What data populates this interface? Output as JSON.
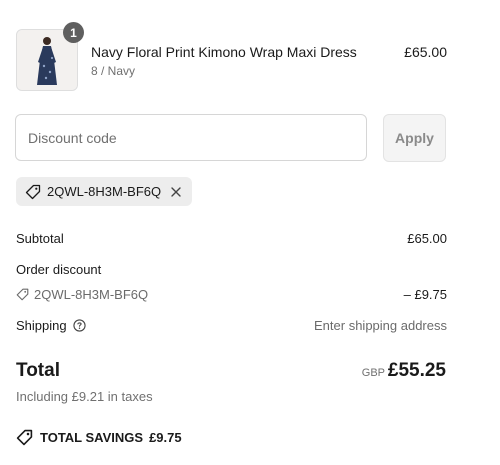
{
  "product": {
    "quantity": "1",
    "name": "Navy Floral Print Kimono Wrap Maxi Dress",
    "variant": "8 / Navy",
    "price": "£65.00"
  },
  "discount": {
    "placeholder": "Discount code",
    "apply_label": "Apply",
    "applied_code": "2QWL-8H3M-BF6Q"
  },
  "summary": {
    "subtotal_label": "Subtotal",
    "subtotal_value": "£65.00",
    "order_discount_label": "Order discount",
    "order_discount_code": "2QWL-8H3M-BF6Q",
    "order_discount_value": "– £9.75",
    "shipping_label": "Shipping",
    "shipping_value": "Enter shipping address"
  },
  "total": {
    "label": "Total",
    "currency": "GBP",
    "amount": "£55.25",
    "tax_note": "Including £9.21 in taxes"
  },
  "savings": {
    "label": "TOTAL SAVINGS",
    "amount": "£9.75"
  },
  "icons": {
    "tag": "tag-icon",
    "remove": "close-icon",
    "info": "info-icon",
    "savings": "price-tag-icon"
  }
}
